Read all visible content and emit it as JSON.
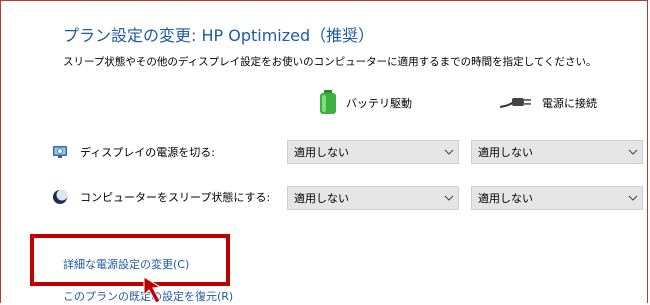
{
  "page": {
    "title": "プラン設定の変更: HP Optimized（推奨）",
    "description": "スリープ状態やその他のディスプレイ設定をお使いのコンピューターに適用するまでの時間を指定してください。"
  },
  "columns": {
    "battery_label": "バッテリ駆動",
    "plugged_label": "電源に接続",
    "battery_icon": "battery-icon",
    "plug_icon": "power-plug-icon"
  },
  "rows": [
    {
      "label": "ディスプレイの電源を切る:",
      "icon": "display-icon",
      "battery_value": "適用しない",
      "plugged_value": "適用しない"
    },
    {
      "label": "コンピューターをスリープ状態にする:",
      "icon": "sleep-moon-icon",
      "battery_value": "適用しない",
      "plugged_value": "適用しない"
    }
  ],
  "links": {
    "advanced": "詳細な電源設定の変更(C)",
    "restore": "このプランの既定の設定を復元(R)"
  },
  "colors": {
    "link": "#1e5aa8",
    "highlight": "#c00000",
    "battery": "#3cb043"
  }
}
